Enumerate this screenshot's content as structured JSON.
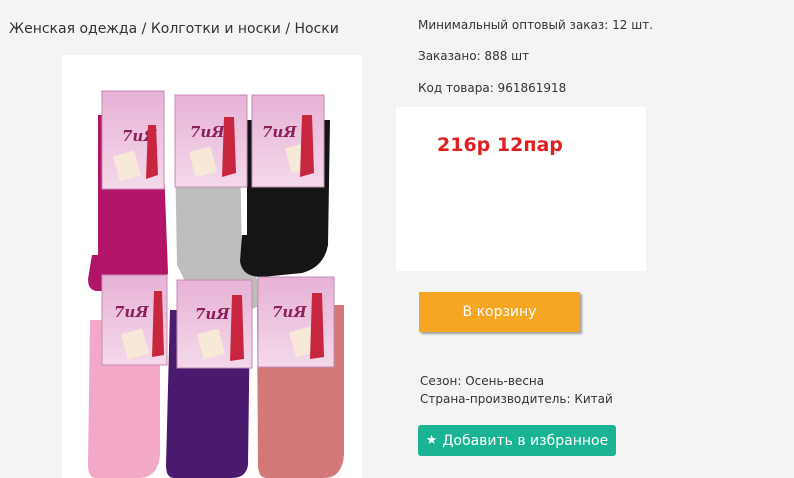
{
  "breadcrumb": {
    "items": [
      "Женская одежда",
      "Колготки и носки",
      "Носки"
    ],
    "separator": " / "
  },
  "product": {
    "image_alt": "Носки 7иЯ, упаковка 6 пар",
    "min_order": "Минимальный оптовый заказ: 12 шт.",
    "ordered": "Заказано: 888 шт",
    "sku": "Код товара: 961861918",
    "price": "216р 12пар",
    "season": "Сезон: Осень-весна",
    "country": "Страна-производитель: Китай"
  },
  "buttons": {
    "cart": "В корзину",
    "favorite": "Добавить в избранное",
    "favorite_icon": "star-icon"
  },
  "colors": {
    "price": "#e02020",
    "cart": "#f5a623",
    "favorite": "#1ab394"
  }
}
